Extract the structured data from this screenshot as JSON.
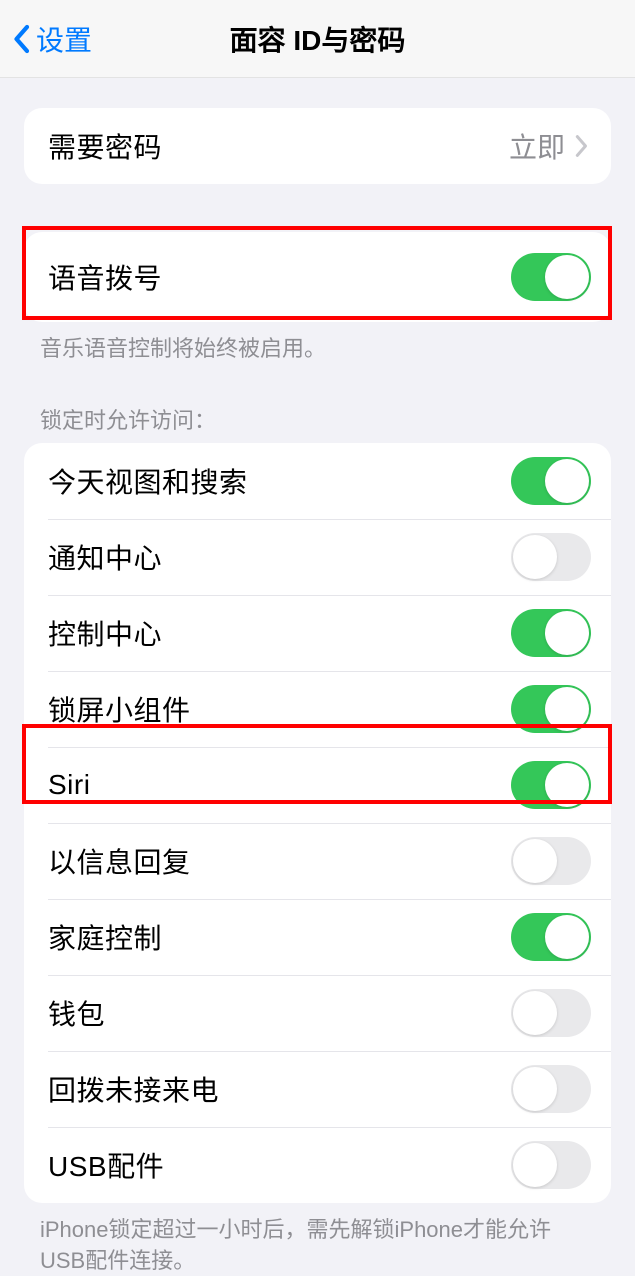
{
  "nav": {
    "back_label": "设置",
    "title": "面容 ID与密码"
  },
  "passcode_group": {
    "require_passcode": {
      "label": "需要密码",
      "value": "立即"
    }
  },
  "voice_dial": {
    "label": "语音拨号",
    "on": true,
    "footer": "音乐语音控制将始终被启用。"
  },
  "lock_access": {
    "header": "锁定时允许访问：",
    "items": [
      {
        "label": "今天视图和搜索",
        "on": true
      },
      {
        "label": "通知中心",
        "on": false
      },
      {
        "label": "控制中心",
        "on": true
      },
      {
        "label": "锁屏小组件",
        "on": true
      },
      {
        "label": "Siri",
        "on": true
      },
      {
        "label": "以信息回复",
        "on": false
      },
      {
        "label": "家庭控制",
        "on": true
      },
      {
        "label": "钱包",
        "on": false
      },
      {
        "label": "回拨未接来电",
        "on": false
      },
      {
        "label": "USB配件",
        "on": false
      }
    ],
    "footer": "iPhone锁定超过一小时后，需先解锁iPhone才能允许USB配件连接。"
  }
}
